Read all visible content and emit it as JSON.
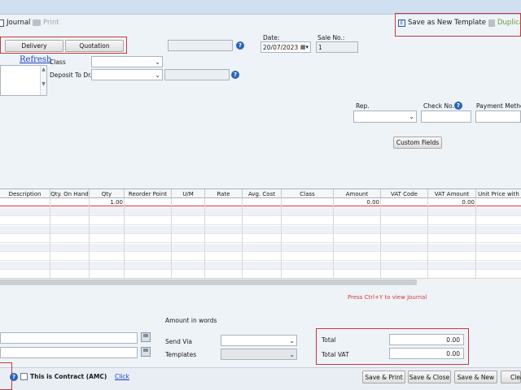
{
  "toolbar": {
    "journal_label": "Journal",
    "print_label": "Print",
    "save_template_label": "Save as New Template",
    "duplicate_label": "Duplicat"
  },
  "header": {
    "delivery_button": "Delivery",
    "quotation_button": "Quotation",
    "refresh_link": "Refresh",
    "class_label": "Class",
    "deposit_label": "Deposit To Dr.",
    "date_label": "Date:",
    "date_value": "20/07/2023",
    "sale_no_label": "Sale No.:",
    "sale_no_value": "1",
    "rep_label": "Rep.",
    "check_no_label": "Check No.",
    "payment_method_label": "Payment Method",
    "custom_fields_button": "Custom Fields"
  },
  "grid": {
    "columns": [
      "Description",
      "Qty. On Hand",
      "Qty",
      "Reorder Point",
      "U/M",
      "Rate",
      "Avg. Cost",
      "Class",
      "Amount",
      "VAT Code",
      "VAT Amount",
      "Unit Price with"
    ],
    "row1": {
      "qty": "1.00",
      "amount": "0.00",
      "vat_amount": "0.00"
    }
  },
  "footer": {
    "journal_hint": "Press Ctrl+Y to view Journal",
    "amount_in_words_label": "Amount in words",
    "send_via_label": "Send Via",
    "templates_label": "Templates",
    "total_label": "Total",
    "total_value": "0.00",
    "total_vat_label": "Total VAT",
    "total_vat_value": "0.00",
    "contract_label": "This is Contract (AMC)",
    "click_link": "Click"
  },
  "actions": {
    "save_print": "Save & Print",
    "save_close": "Save & Close",
    "save_new": "Save & New",
    "clear": "Clea"
  },
  "colors": {
    "highlight_red": "#c6393b",
    "hint_red": "#d23a3a",
    "link_blue": "#1a3fc7",
    "help_blue": "#2c63b8"
  }
}
